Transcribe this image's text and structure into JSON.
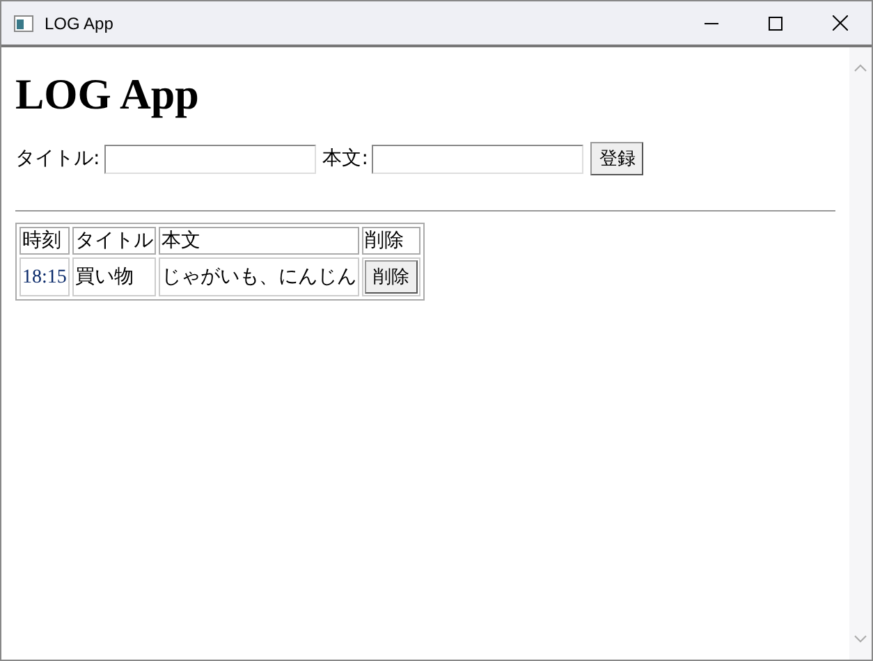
{
  "window": {
    "title": "LOG App"
  },
  "heading": "LOG App",
  "form": {
    "title_label": "タイトル:",
    "body_label": "本文:",
    "submit": "登録"
  },
  "table": {
    "columns": [
      "時刻",
      "タイトル",
      "本文",
      "削除"
    ],
    "rows": [
      {
        "time": "18:15",
        "title": "買い物",
        "body": "じゃがいも、にんじん",
        "action": "削除"
      }
    ]
  }
}
